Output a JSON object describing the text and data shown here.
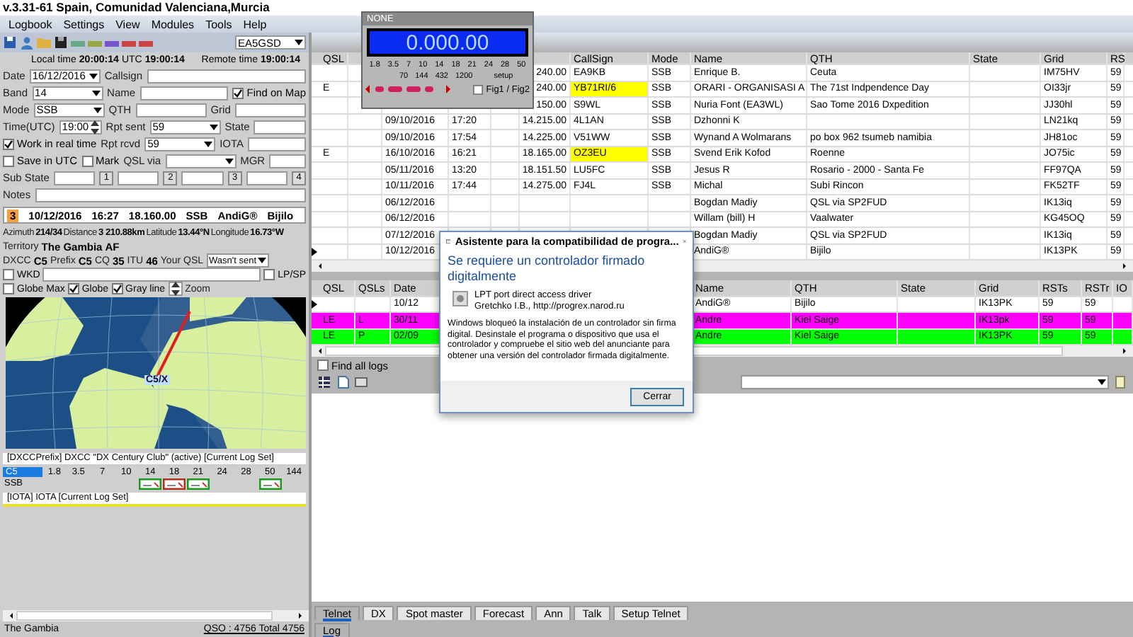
{
  "window": {
    "title": "v.3.31-61 Spain, Comunidad Valenciana,Murcia"
  },
  "menu": [
    "Logbook",
    "Settings",
    "View",
    "Modules",
    "Tools",
    "Help"
  ],
  "station": {
    "callsign": "EA5GSD"
  },
  "clock": {
    "local_label": "Local time",
    "local": "20:00:14",
    "utc_label": "UTC",
    "utc": "19:00:14",
    "remote_label": "Remote time",
    "remote": "19:00:14"
  },
  "form": {
    "lines": [
      {
        "items": [
          {
            "kind": "label",
            "text": "Date"
          },
          {
            "kind": "select",
            "value": "16/12/2016"
          },
          {
            "kind": "label",
            "text": "Callsign"
          },
          {
            "kind": "input"
          }
        ]
      },
      {
        "items": [
          {
            "kind": "label",
            "text": "Band"
          },
          {
            "kind": "select",
            "value": "14"
          },
          {
            "kind": "label",
            "text": "Name"
          },
          {
            "kind": "input"
          },
          {
            "kind": "checkbox",
            "label": "Find on Map",
            "checked": true
          }
        ]
      },
      {
        "items": [
          {
            "kind": "label",
            "text": "Mode"
          },
          {
            "kind": "select",
            "value": "SSB"
          },
          {
            "kind": "label",
            "text": "QTH"
          },
          {
            "kind": "input"
          },
          {
            "kind": "label",
            "text": "Grid"
          },
          {
            "kind": "input"
          }
        ]
      },
      {
        "items": [
          {
            "kind": "label",
            "text": "Time(UTC)"
          },
          {
            "kind": "spin",
            "value": "19:00"
          },
          {
            "kind": "label",
            "text": "Rpt sent"
          },
          {
            "kind": "select",
            "value": "59"
          },
          {
            "kind": "label",
            "text": "State"
          },
          {
            "kind": "input"
          }
        ]
      },
      {
        "items": [
          {
            "kind": "checkbox",
            "label": "Work in real time",
            "checked": true
          },
          {
            "kind": "label",
            "text": "Rpt rcvd"
          },
          {
            "kind": "select",
            "value": "59"
          },
          {
            "kind": "label",
            "text": "IOTA"
          },
          {
            "kind": "input"
          }
        ]
      },
      {
        "items": [
          {
            "kind": "checkbox",
            "label": "Save in UTC",
            "checked": false
          },
          {
            "kind": "checkbox",
            "label": "Mark",
            "checked": false
          },
          {
            "kind": "label",
            "text": "QSL via"
          },
          {
            "kind": "select"
          },
          {
            "kind": "label",
            "text": "MGR"
          },
          {
            "kind": "input"
          }
        ]
      },
      {
        "items": [
          {
            "kind": "label",
            "text": "Sub State"
          },
          {
            "kind": "input"
          },
          {
            "kind": "button",
            "text": "1"
          },
          {
            "kind": "input"
          },
          {
            "kind": "button",
            "text": "2"
          },
          {
            "kind": "input"
          },
          {
            "kind": "button",
            "text": "3"
          },
          {
            "kind": "input"
          },
          {
            "kind": "button",
            "text": "4"
          }
        ]
      },
      {
        "items": [
          {
            "kind": "label",
            "text": "Notes"
          },
          {
            "kind": "input"
          }
        ]
      }
    ]
  },
  "last_qso": {
    "number": "3",
    "date": "10/12/2016",
    "time": "16:27",
    "frequency": "18.160.00",
    "mode": "SSB",
    "callsign": "AndiG®",
    "qth": "Bijilo"
  },
  "info_lines": [
    {
      "items": [
        {
          "kind": "label",
          "text": "Azimuth"
        },
        {
          "kind": "value",
          "text": "214/34"
        },
        {
          "kind": "label",
          "text": "Distance"
        },
        {
          "kind": "value",
          "text": "3 210.88km"
        },
        {
          "kind": "label",
          "text": "Latitude"
        },
        {
          "kind": "value",
          "text": "13.44°N"
        },
        {
          "kind": "label",
          "text": "Longitude"
        },
        {
          "kind": "value",
          "text": "16.73°W"
        }
      ]
    },
    {
      "items": [
        {
          "kind": "label",
          "text": "Territory"
        },
        {
          "kind": "value",
          "text": "The Gambia"
        },
        {
          "kind": "value",
          "text": "AF"
        }
      ]
    },
    {
      "items": [
        {
          "kind": "label",
          "text": "DXCC"
        },
        {
          "kind": "value",
          "text": "C5"
        },
        {
          "kind": "label",
          "text": "Prefix"
        },
        {
          "kind": "value",
          "text": "C5"
        },
        {
          "kind": "label",
          "text": "CQ"
        },
        {
          "kind": "value",
          "text": "35"
        },
        {
          "kind": "label",
          "text": "ITU"
        },
        {
          "kind": "value",
          "text": "46"
        },
        {
          "kind": "label",
          "text": "Your QSL"
        },
        {
          "kind": "select",
          "value": "Wasn't sent"
        }
      ]
    },
    {
      "items": [
        {
          "kind": "checkbox",
          "label": "WKD",
          "checked": false
        },
        {
          "kind": "input"
        },
        {
          "kind": "checkbox",
          "label": "LP/SP",
          "checked": false
        }
      ]
    },
    {
      "items": [
        {
          "kind": "checkbox",
          "label": "Globe Max",
          "checked": false
        },
        {
          "kind": "checkbox",
          "label": "Globe",
          "checked": true
        },
        {
          "kind": "checkbox",
          "label": "Gray line",
          "checked": true
        },
        {
          "kind": "spin"
        },
        {
          "kind": "label",
          "text": "Zoom"
        }
      ]
    }
  ],
  "map": {
    "label": "C5/X"
  },
  "dxcc_panel": {
    "title": "[DXCCPrefix] DXCC \"DX Century Club\" (active) [Current Log Set]",
    "prefix": "C5",
    "mode": "SSB",
    "bands": [
      {
        "label": "1.8",
        "kind": "none"
      },
      {
        "label": "3.5",
        "kind": "none"
      },
      {
        "label": "7",
        "kind": "none"
      },
      {
        "label": "10",
        "kind": "none"
      },
      {
        "label": "14",
        "kind": "worked"
      },
      {
        "label": "18",
        "kind": "confirmed"
      },
      {
        "label": "21",
        "kind": "worked"
      },
      {
        "label": "24",
        "kind": "none"
      },
      {
        "label": "28",
        "kind": "none"
      },
      {
        "label": "50",
        "kind": "worked"
      },
      {
        "label": "144",
        "kind": "none"
      }
    ]
  },
  "iota_panel": {
    "title": "[IOTA] IOTA [Current Log Set]"
  },
  "status_bar": {
    "country": "The Gambia",
    "count": "QSO : 4756 Total 4756"
  },
  "vfo": {
    "title": "NONE",
    "frequency": "0.000.00",
    "bands": [
      "1.8",
      "3.5",
      "7",
      "10",
      "14",
      "18",
      "21",
      "24",
      "28",
      "50"
    ],
    "bands2": [
      "70",
      "144",
      "432",
      "1200"
    ],
    "setup": "setup",
    "fig_label": "Fig1 / Fig2",
    "fig_checked": false
  },
  "log": {
    "headers": {
      "qsl": "QSL",
      "callsign": "CallSign",
      "mode": "Mode",
      "name": "Name",
      "qth": "QTH",
      "state": "State",
      "grid": "Grid",
      "rs": "RS"
    },
    "rows": [
      {
        "frequency": "240.00",
        "callsign": "EA9KB",
        "highlight": false,
        "current": false,
        "mode": "SSB",
        "name": "Enrique B.",
        "qth": "Ceuta",
        "grid": "IM75HV",
        "rs": "59"
      },
      {
        "qsl": "E",
        "frequency": "240.00",
        "callsign": "YB71RI/6",
        "highlight": true,
        "current": false,
        "mode": "SSB",
        "name": "ORARI - ORGANISASI A",
        "qth": "The 71st Indpendence Day",
        "grid": "OI33jr",
        "rs": "59"
      },
      {
        "frequency": "150.00",
        "callsign": "S9WL",
        "highlight": false,
        "current": false,
        "mode": "SSB",
        "name": "Nuria Font (EA3WL)",
        "qth": "Sao Tome 2016 Dxpedition",
        "grid": "JJ30hl",
        "rs": "59"
      },
      {
        "date": "09/10/2016",
        "time": "17:20",
        "frequency": "14.215.00",
        "callsign": "4L1AN",
        "highlight": false,
        "current": false,
        "mode": "SSB",
        "name": "Dzhonni K",
        "grid": "LN21kq",
        "rs": "59"
      },
      {
        "date": "09/10/2016",
        "time": "17:54",
        "frequency": "14.225.00",
        "callsign": "V51WW",
        "highlight": false,
        "current": false,
        "mode": "SSB",
        "name": "Wynand A Wolmarans",
        "qth": "po box 962 tsumeb namibia",
        "grid": "JH81oc",
        "rs": "59"
      },
      {
        "qsl": "E",
        "date": "16/10/2016",
        "time": "16:21",
        "frequency": "18.165.00",
        "callsign": "OZ3EU",
        "highlight": true,
        "current": false,
        "mode": "SSB",
        "name": "Svend Erik Kofod",
        "qth": "Roenne",
        "grid": "JO75ic",
        "rs": "59"
      },
      {
        "date": "05/11/2016",
        "time": "13:20",
        "frequency": "18.151.50",
        "callsign": "LU5FC",
        "highlight": false,
        "current": false,
        "mode": "SSB",
        "name": "Jesus R",
        "qth": "Rosario - 2000 - Santa Fe",
        "grid": "FF97QA",
        "rs": "59"
      },
      {
        "date": "10/11/2016",
        "time": "17:44",
        "frequency": "14.275.00",
        "callsign": "FJ4L",
        "highlight": false,
        "current": false,
        "mode": "SSB",
        "name": "Michal",
        "qth": "Subi Rincon",
        "grid": "FK52TF",
        "rs": "59"
      },
      {
        "date": "06/12/2016",
        "highlight": false,
        "current": false,
        "name": "Bogdan Madiy",
        "qth": "QSL via SP2FUD",
        "grid": "IK13iq",
        "rs": "59"
      },
      {
        "date": "06/12/2016",
        "highlight": false,
        "current": false,
        "name": "Willam (bill) H",
        "qth": "Vaalwater",
        "grid": "KG45OQ",
        "rs": "59"
      },
      {
        "date": "07/12/2016",
        "highlight": false,
        "current": false,
        "name": "Bogdan Madiy",
        "qth": "QSL via SP2FUD",
        "grid": "IK13iq",
        "rs": "59"
      },
      {
        "date": "10/12/2016",
        "highlight": false,
        "current": true,
        "name": "AndiG®",
        "qth": "Bijilo",
        "grid": "IK13PK",
        "rs": "59"
      }
    ]
  },
  "dupes": {
    "headers": {
      "qsl": "QSL",
      "qsls": "QSLs",
      "date": "Date",
      "name": "Name",
      "qth": "QTH",
      "state": "State",
      "grid": "Grid",
      "rsts": "RSTs",
      "rstr": "RSTr",
      "io": "IO"
    },
    "rows": [
      {
        "date": "10/12",
        "name": "AndiG®",
        "qth": "Bijilo",
        "grid": "IK13PK",
        "rsts": "59",
        "rstr": "59",
        "color": "#ffffff",
        "current": true
      },
      {
        "qsl": "LE",
        "qsls": "L",
        "date": "30/11",
        "name": "Andre",
        "qth": "Kiel Saige",
        "grid": "IK13pk",
        "rsts": "59",
        "rstr": "59",
        "color": "#ff00ff",
        "current": false
      },
      {
        "qsl": "LE",
        "qsls": "P",
        "date": "02/09",
        "name": "Andre",
        "qth": "Kiel Saige",
        "grid": "IK13PK",
        "rsts": "59",
        "rstr": "59",
        "color": "#00ff00",
        "current": false
      }
    ]
  },
  "find_all_logs": {
    "label": "Find all logs",
    "checked": false
  },
  "tabs": [
    {
      "label": "Telnet",
      "selected": true
    },
    {
      "label": "DX",
      "selected": false
    },
    {
      "label": "Spot master",
      "selected": false
    },
    {
      "label": "Forecast",
      "selected": false
    },
    {
      "label": "Ann",
      "selected": false
    },
    {
      "label": "Talk",
      "selected": false
    },
    {
      "label": "Setup Telnet",
      "selected": false
    }
  ],
  "bottom_tabs": [
    {
      "label": "Log",
      "selected": true
    }
  ],
  "dialog": {
    "title": "Asistente para la compatibilidad de progra...",
    "heading": "Se requiere un controlador firmado digitalmente",
    "driver_name": "LPT port direct access driver",
    "driver_vendor": "Gretchko I.B., http://progrex.narod.ru",
    "message": "Windows bloqueó la instalación de un controlador sin firma digital. Desinstale el programa o dispositivo que usa el controlador y compruebe el sitio web del anunciante para obtener una versión del controlador firmada digitalmente.",
    "button": "Cerrar"
  }
}
